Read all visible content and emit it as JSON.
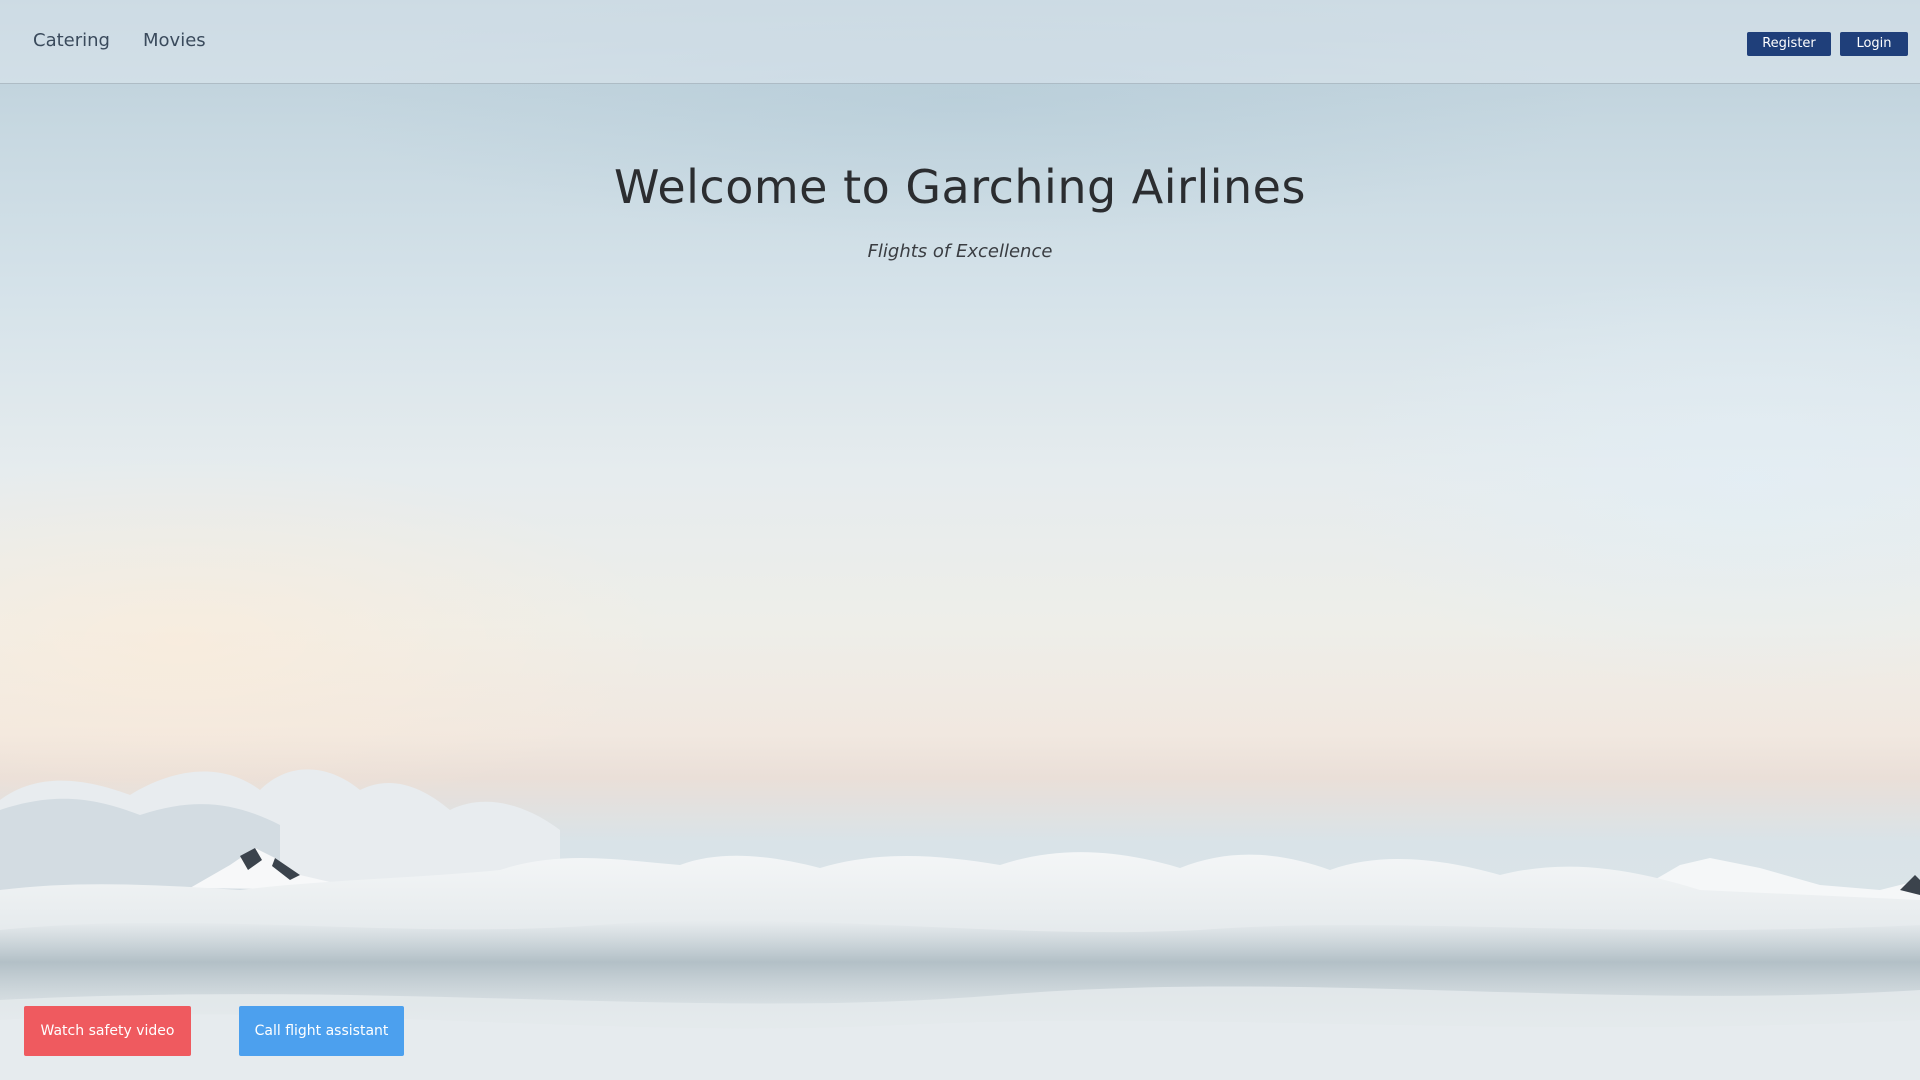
{
  "nav": {
    "links": [
      "Catering",
      "Movies"
    ],
    "register_label": "Register",
    "login_label": "Login"
  },
  "hero": {
    "title": "Welcome to Garching Airlines",
    "subtitle": "Flights of Excellence"
  },
  "actions": {
    "safety_video_label": "Watch safety video",
    "flight_assistant_label": "Call flight assistant"
  },
  "colors": {
    "nav_button": "#1f3f7a",
    "safety_button": "#ef5a5f",
    "assistant_button": "#4ca0ee",
    "text_dark": "#2b2d30"
  }
}
